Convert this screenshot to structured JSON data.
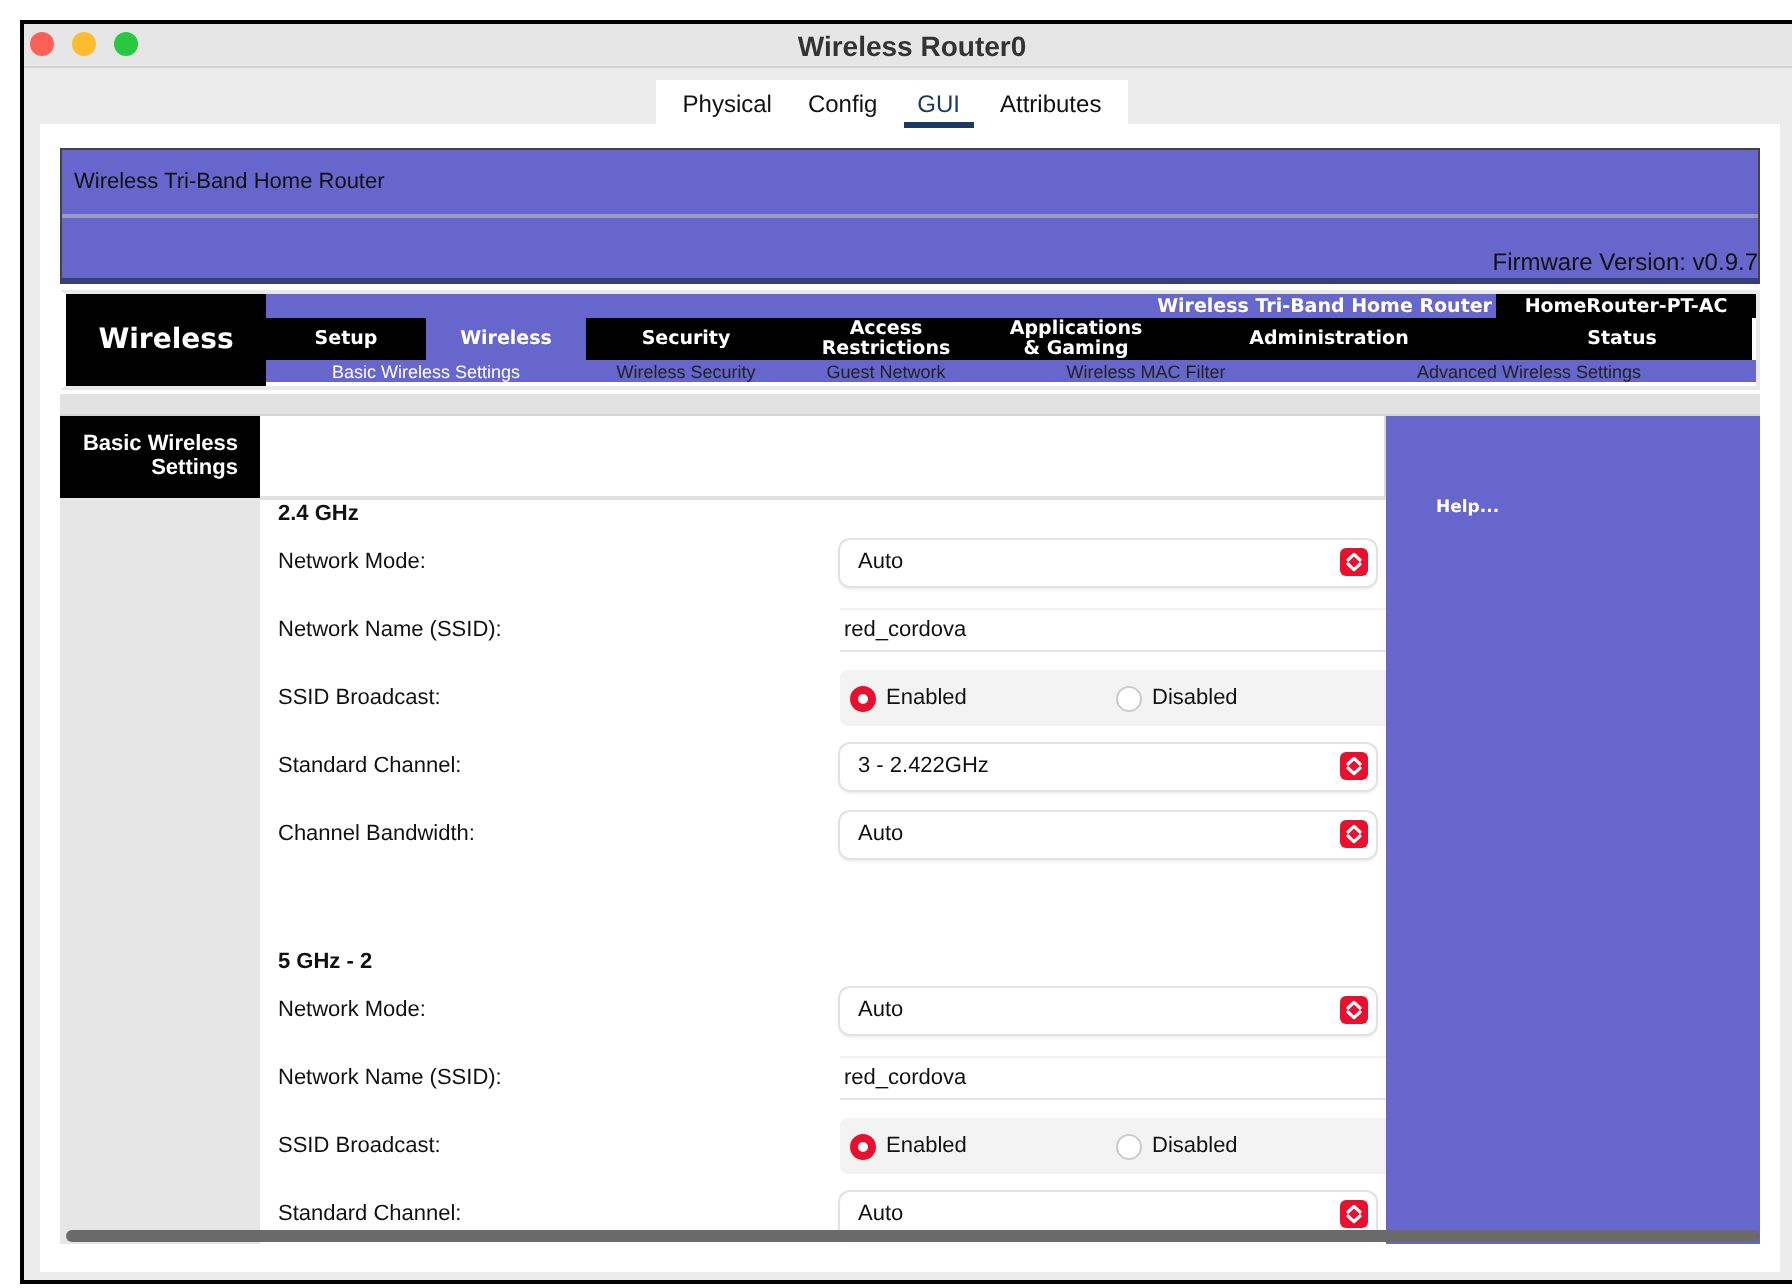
{
  "window": {
    "title": "Wireless Router0"
  },
  "tabs": [
    {
      "label": "Physical",
      "selected": false
    },
    {
      "label": "Config",
      "selected": false
    },
    {
      "label": "GUI",
      "selected": true
    },
    {
      "label": "Attributes",
      "selected": false
    }
  ],
  "router": {
    "banner_title": "Wireless Tri-Band Home Router",
    "firmware": "Firmware Version: v0.9.7",
    "logo": "Wireless",
    "product": "Wireless Tri-Band Home Router",
    "model": "HomeRouter-PT-AC",
    "nav_tabs": [
      {
        "label": "Setup",
        "selected": false
      },
      {
        "label": "Wireless",
        "selected": true
      },
      {
        "label": "Security",
        "selected": false
      },
      {
        "label": "Access\nRestrictions",
        "selected": false
      },
      {
        "label": "Applications\n& Gaming",
        "selected": false
      },
      {
        "label": "Administration",
        "selected": false
      },
      {
        "label": "Status",
        "selected": false
      }
    ],
    "sub_links": [
      {
        "label": "Basic Wireless Settings",
        "selected": true
      },
      {
        "label": "Wireless Security",
        "selected": false
      },
      {
        "label": "Guest Network",
        "selected": false
      },
      {
        "label": "Wireless MAC Filter",
        "selected": false
      },
      {
        "label": "Advanced Wireless Settings",
        "selected": false
      }
    ],
    "sidebar_heading": "Basic Wireless\nSettings",
    "help_link": "Help...",
    "sections": [
      {
        "title": "2.4 GHz",
        "rows": [
          {
            "kind": "select",
            "label": "Network Mode:",
            "value": "Auto"
          },
          {
            "kind": "text",
            "label": "Network Name (SSID):",
            "value": "red_cordova"
          },
          {
            "kind": "radio",
            "label": "SSID Broadcast:",
            "options": [
              {
                "label": "Enabled",
                "selected": true
              },
              {
                "label": "Disabled",
                "selected": false
              }
            ]
          },
          {
            "kind": "select",
            "label": "Standard Channel:",
            "value": "3 - 2.422GHz"
          },
          {
            "kind": "select",
            "label": "Channel Bandwidth:",
            "value": "Auto"
          }
        ]
      },
      {
        "title": "5 GHz - 2",
        "rows": [
          {
            "kind": "select",
            "label": "Network Mode:",
            "value": "Auto"
          },
          {
            "kind": "text",
            "label": "Network Name (SSID):",
            "value": "red_cordova"
          },
          {
            "kind": "radio",
            "label": "SSID Broadcast:",
            "options": [
              {
                "label": "Enabled",
                "selected": true
              },
              {
                "label": "Disabled",
                "selected": false
              }
            ]
          },
          {
            "kind": "select",
            "label": "Standard Channel:",
            "value": "Auto"
          }
        ]
      }
    ]
  }
}
